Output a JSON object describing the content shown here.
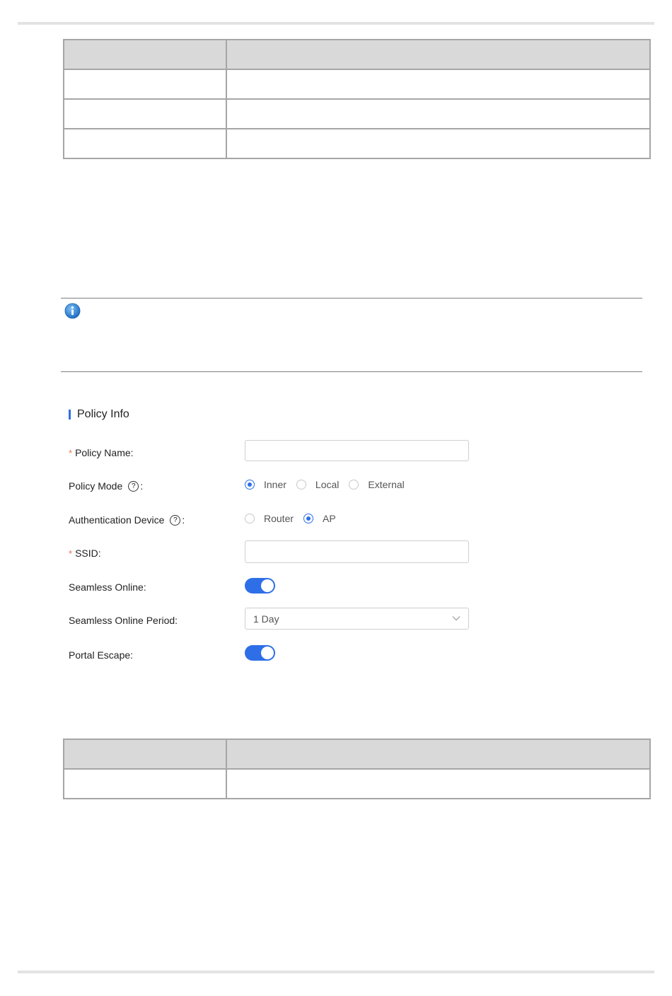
{
  "form": {
    "section_title": "Policy Info",
    "required_mark": "*",
    "policy_name": {
      "label": "Policy Name:",
      "value": ""
    },
    "policy_mode": {
      "label": "Policy Mode",
      "suffix": ":",
      "help_glyph": "?",
      "options": [
        "Inner",
        "Local",
        "External"
      ],
      "selected": "Inner"
    },
    "auth_device": {
      "label": "Authentication Device",
      "suffix": ":",
      "help_glyph": "?",
      "options": [
        "Router",
        "AP"
      ],
      "selected": "AP"
    },
    "ssid": {
      "label": "SSID:",
      "value": ""
    },
    "seamless_online": {
      "label": "Seamless Online:",
      "enabled": true
    },
    "seamless_online_period": {
      "label": "Seamless Online Period:",
      "value": "1 Day"
    },
    "portal_escape": {
      "label": "Portal Escape:",
      "enabled": true
    }
  },
  "colors": {
    "accent": "#2e6fe8",
    "required": "#e8734a",
    "table_header": "#d9d9d9",
    "table_border": "#a6a6a6"
  },
  "icons": {
    "note": "info-icon",
    "help": "question-circle-icon",
    "dropdown": "chevron-down-icon"
  }
}
